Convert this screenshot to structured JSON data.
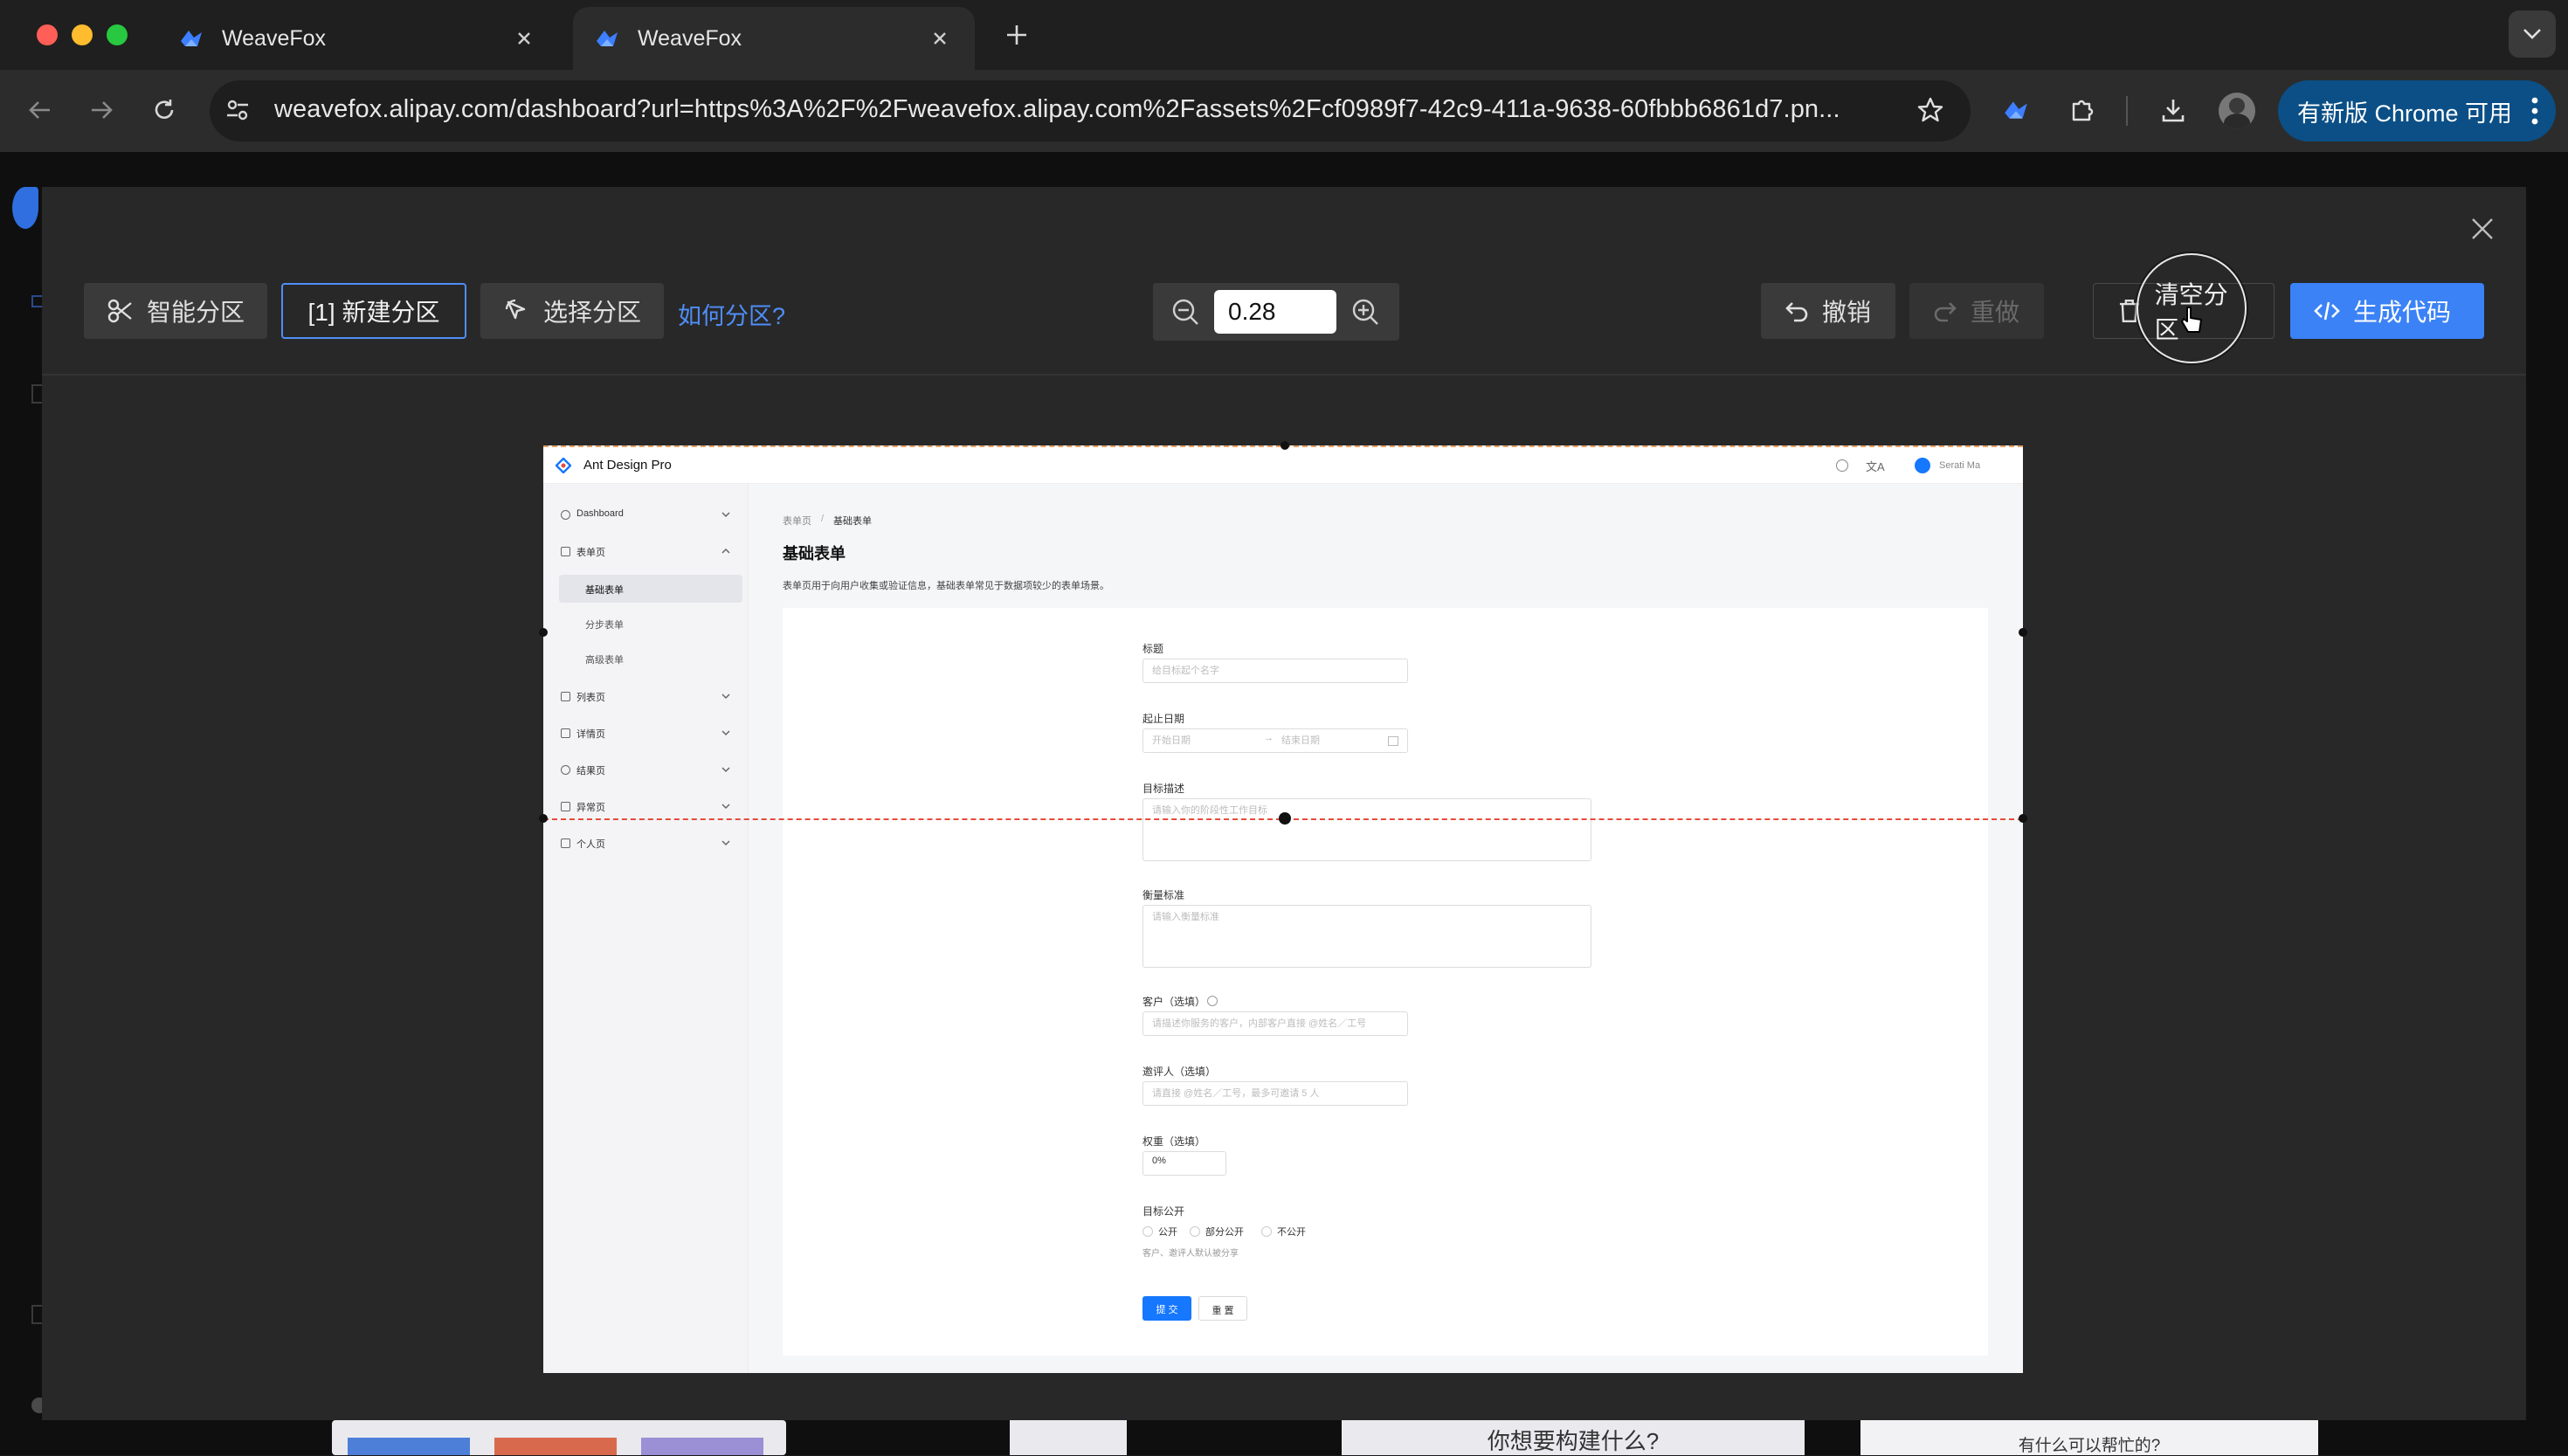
{
  "browser": {
    "tabs": [
      {
        "title": "WeaveFox",
        "active": false
      },
      {
        "title": "WeaveFox",
        "active": true
      }
    ],
    "url": "weavefox.alipay.com/dashboard?url=https%3A%2F%2Fweavefox.alipay.com%2Fassets%2Fcf0989f7-42c9-411a-9638-60fbbb6861d7.pn...",
    "update_button": "有新版 Chrome 可用"
  },
  "toolbar": {
    "smart_partition": "智能分区",
    "new_partition": "[1] 新建分区",
    "select_partition": "选择分区",
    "how_to_partition": "如何分区?",
    "zoom_value": "0.28",
    "undo": "撤销",
    "redo": "重做",
    "clear_partition": "清空分区",
    "generate_code": "生成代码"
  },
  "preview": {
    "app_title": "Ant Design Pro",
    "user": "Serati Ma",
    "menu": [
      {
        "label": "Dashboard",
        "expanded": false
      },
      {
        "label": "表单页",
        "expanded": true
      },
      {
        "label": "基础表单",
        "sub": true,
        "active": true
      },
      {
        "label": "分步表单",
        "sub": true
      },
      {
        "label": "高级表单",
        "sub": true
      },
      {
        "label": "列表页",
        "expanded": false
      },
      {
        "label": "详情页",
        "expanded": false
      },
      {
        "label": "结果页",
        "expanded": false
      },
      {
        "label": "异常页",
        "expanded": false
      },
      {
        "label": "个人页",
        "expanded": false
      }
    ],
    "breadcrumb_root": "表单页",
    "breadcrumb_sep": "/",
    "breadcrumb_current": "基础表单",
    "page_title": "基础表单",
    "page_desc": "表单页用于向用户收集或验证信息，基础表单常见于数据项较少的表单场景。",
    "form": {
      "title_label": "标题",
      "title_placeholder": "给目标起个名字",
      "date_label": "起止日期",
      "date_start": "开始日期",
      "date_end": "结束日期",
      "goal_label": "目标描述",
      "goal_placeholder": "请输入你的阶段性工作目标",
      "standard_label": "衡量标准",
      "standard_placeholder": "请输入衡量标准",
      "client_label": "客户（选填）",
      "client_placeholder": "请描述你服务的客户，内部客户直接 @姓名／工号",
      "reviewer_label": "邀评人（选填）",
      "reviewer_placeholder": "请直接 @姓名／工号，最多可邀请 5 人",
      "weight_label": "权重（选填）",
      "weight_value": "0%",
      "public_label": "目标公开",
      "public_options": [
        "公开",
        "部分公开",
        "不公开"
      ],
      "public_hint": "客户、邀评人默认被分享",
      "submit": "提 交",
      "reset": "重 置"
    }
  },
  "background": {
    "prompt_1": "你想要构建什么?",
    "prompt_2": "有什么可以帮忙的?"
  },
  "colors": {
    "primary": "#3b82f6",
    "partition_line": "#e74c3c",
    "modal_bg": "#282828"
  }
}
